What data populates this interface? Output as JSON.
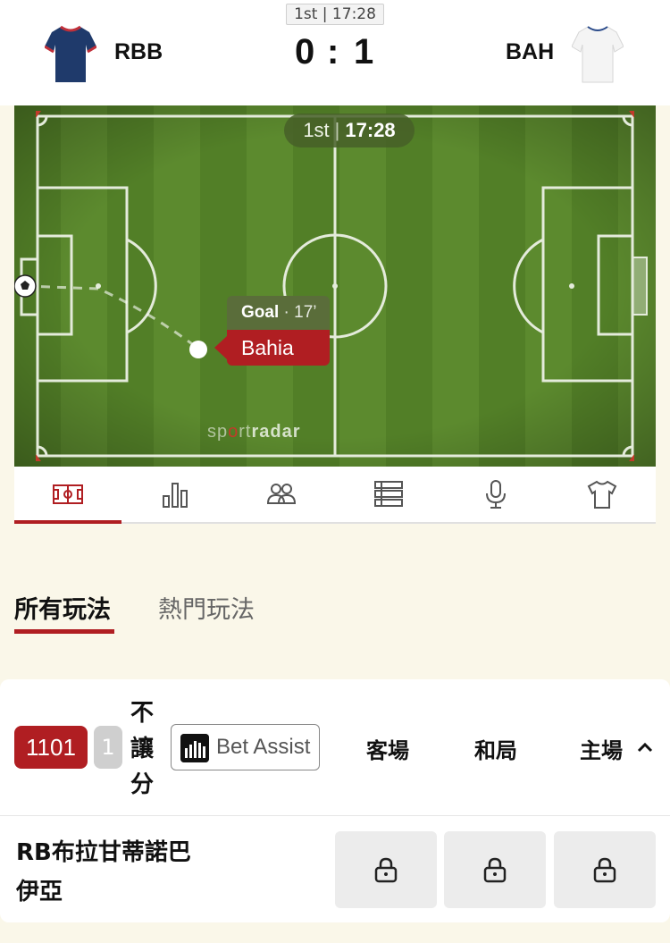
{
  "match": {
    "period_clock": "1st | 17:28",
    "home": {
      "name": "RBB",
      "score": "0",
      "jersey_color": "#1f3a6b"
    },
    "score_separator": ":",
    "away": {
      "name": "BAH",
      "score": "1",
      "jersey_color": "#f4f4f4"
    }
  },
  "pitch": {
    "clock": {
      "period": "1st",
      "time": "17:28"
    },
    "event": {
      "type": "Goal",
      "minute": "· 17’",
      "team": "Bahia"
    },
    "watermark": {
      "part1": "sp",
      "mark": "o",
      "part2": "rt",
      "brand": "radar"
    },
    "colors": {
      "grass_light": "#5c8a2e",
      "grass_dark": "#4f7d26",
      "line": "#e8eee0"
    }
  },
  "icon_tabs": [
    {
      "icon": "pitch-icon",
      "active": true
    },
    {
      "icon": "stats-bar-icon",
      "active": false
    },
    {
      "icon": "lineups-icon",
      "active": false
    },
    {
      "icon": "list-icon",
      "active": false
    },
    {
      "icon": "microphone-icon",
      "active": false
    },
    {
      "icon": "jersey-icon",
      "active": false
    }
  ],
  "market_tabs": {
    "all": "所有玩法",
    "popular": "熱門玩法"
  },
  "market": {
    "id": "1101",
    "count": "1",
    "name": "不讓分",
    "bet_assist": "Bet Assist",
    "columns": {
      "away": "客場",
      "draw": "和局",
      "home": "主場"
    },
    "row": {
      "team": "RB布拉甘蒂諾巴伊亞",
      "odds_locked": true
    }
  },
  "accent_color": "#b01e22"
}
